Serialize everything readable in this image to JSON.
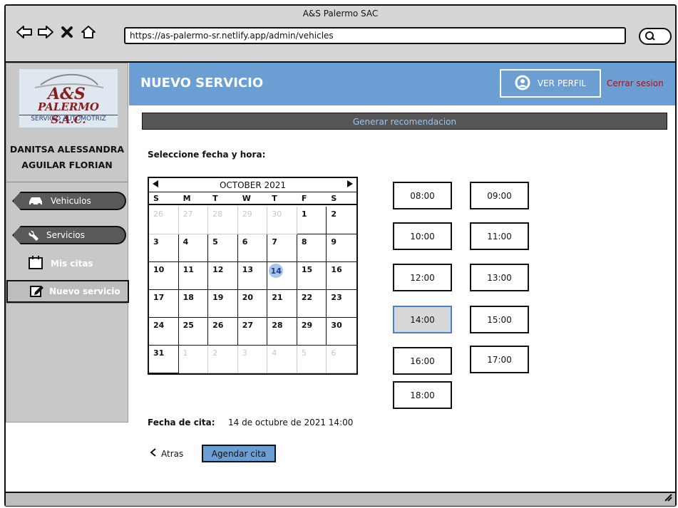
{
  "window": {
    "title": "A&S Palermo SAC",
    "url": "https://as-palermo-sr.netlify.app/admin/vehicles"
  },
  "sidebar": {
    "logo_text": "PALERMO S.A.C.",
    "logo_monogram": "A&S",
    "logo_sub": "SERVICIO AUTOMOTRIZ",
    "user_name_line1": "DANITSA ALESSANDRA",
    "user_name_line2": "AGUILAR FLORIAN",
    "items": [
      {
        "label": "Vehiculos"
      },
      {
        "label": "Servicios"
      },
      {
        "label": "Mis citas"
      },
      {
        "label": "Nuevo servicio"
      }
    ]
  },
  "header": {
    "title": "NUEVO SERVICIO",
    "profile_label": "VER PERFIL",
    "logout_label": "Cerrar sesion"
  },
  "generate_label": "Generar recomendacion",
  "select_label": "Seleccione fecha y hora:",
  "calendar": {
    "month_label": "OCTOBER 2021",
    "weekdays": [
      "S",
      "M",
      "T",
      "W",
      "T",
      "F",
      "S"
    ],
    "days": [
      "26",
      "27",
      "28",
      "29",
      "30",
      "1",
      "2",
      "3",
      "4",
      "5",
      "6",
      "7",
      "8",
      "9",
      "10",
      "11",
      "12",
      "13",
      "14",
      "15",
      "16",
      "17",
      "18",
      "19",
      "20",
      "21",
      "22",
      "23",
      "24",
      "25",
      "26",
      "27",
      "28",
      "29",
      "30",
      "31",
      "1",
      "2",
      "3",
      "4",
      "5",
      "6"
    ],
    "selected_day": "14"
  },
  "times": [
    "08:00",
    "09:00",
    "10:00",
    "11:00",
    "12:00",
    "13:00",
    "14:00",
    "15:00",
    "16:00",
    "17:00",
    "18:00"
  ],
  "selected_time": "14:00",
  "fecha_label": "Fecha de cita:",
  "fecha_value": "14 de octubre de 2021 14:00",
  "back_label": "Atras",
  "submit_label": "Agendar cita",
  "colors": {
    "header_blue": "#6b9fd4",
    "sidebar_gray": "#c8c8c8",
    "logout_red": "#aa1111",
    "selected_day": "#a8c4ec"
  }
}
